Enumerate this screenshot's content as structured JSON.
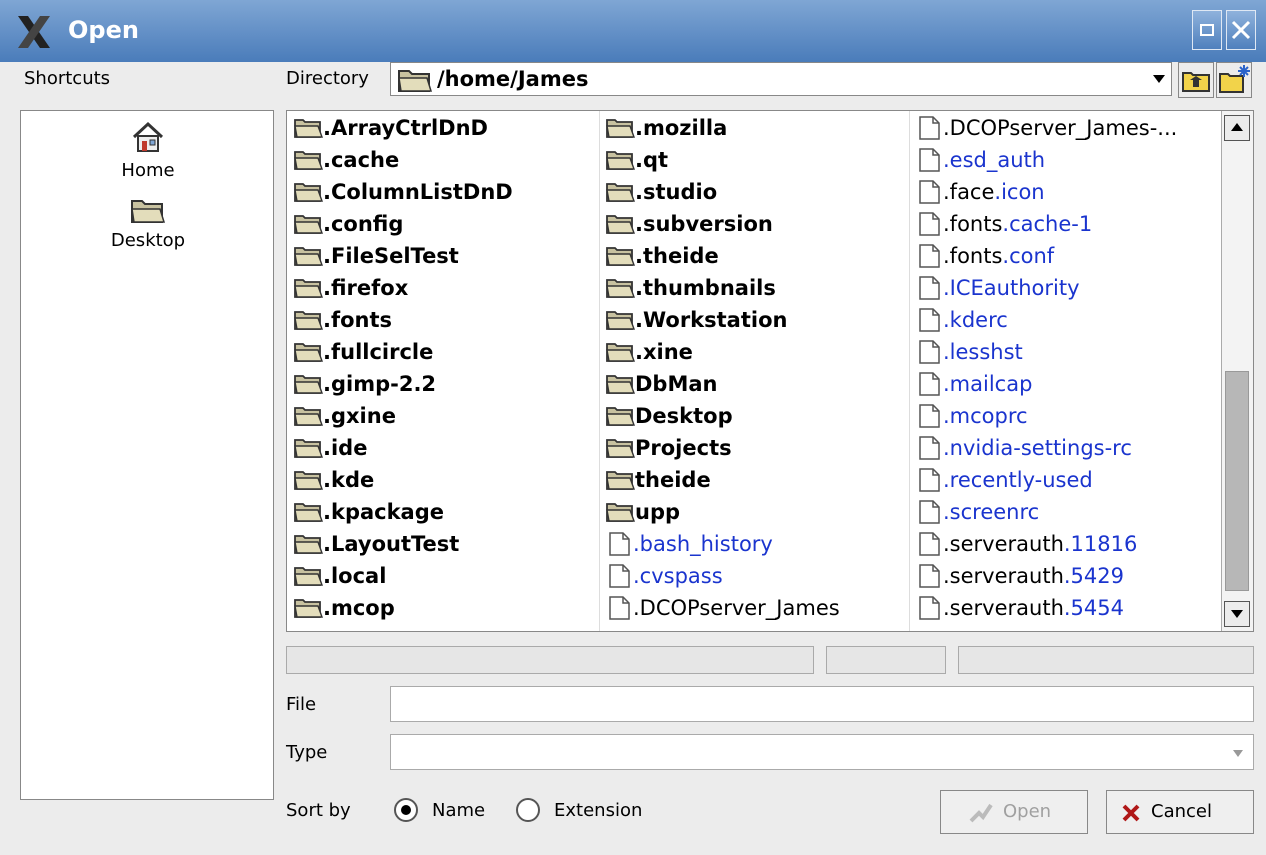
{
  "window": {
    "title": "Open"
  },
  "shortcuts": {
    "label": "Shortcuts",
    "items": [
      {
        "label": "Home"
      },
      {
        "label": "Desktop"
      }
    ]
  },
  "directory": {
    "label": "Directory",
    "value": "/home/James"
  },
  "files": {
    "columns": [
      [
        {
          "name": ".ArrayCtrlDnD",
          "type": "dir"
        },
        {
          "name": ".cache",
          "type": "dir"
        },
        {
          "name": ".ColumnListDnD",
          "type": "dir"
        },
        {
          "name": ".config",
          "type": "dir"
        },
        {
          "name": ".FileSelTest",
          "type": "dir"
        },
        {
          "name": ".firefox",
          "type": "dir"
        },
        {
          "name": ".fonts",
          "type": "dir"
        },
        {
          "name": ".fullcircle",
          "type": "dir"
        },
        {
          "name": ".gimp-2.2",
          "type": "dir"
        },
        {
          "name": ".gxine",
          "type": "dir"
        },
        {
          "name": ".ide",
          "type": "dir"
        },
        {
          "name": ".kde",
          "type": "dir"
        },
        {
          "name": ".kpackage",
          "type": "dir"
        },
        {
          "name": ".LayoutTest",
          "type": "dir"
        },
        {
          "name": ".local",
          "type": "dir"
        },
        {
          "name": ".mcop",
          "type": "dir"
        }
      ],
      [
        {
          "name": ".mozilla",
          "type": "dir"
        },
        {
          "name": ".qt",
          "type": "dir"
        },
        {
          "name": ".studio",
          "type": "dir"
        },
        {
          "name": ".subversion",
          "type": "dir"
        },
        {
          "name": ".theide",
          "type": "dir"
        },
        {
          "name": ".thumbnails",
          "type": "dir"
        },
        {
          "name": ".Workstation",
          "type": "dir"
        },
        {
          "name": ".xine",
          "type": "dir"
        },
        {
          "name": "DbMan",
          "type": "dir"
        },
        {
          "name": "Desktop",
          "type": "dir"
        },
        {
          "name": "Projects",
          "type": "dir"
        },
        {
          "name": "theide",
          "type": "dir"
        },
        {
          "name": "upp",
          "type": "dir"
        },
        {
          "name_a": "",
          "name_b": ".bash_history",
          "type": "file"
        },
        {
          "name_a": "",
          "name_b": ".cvspass",
          "type": "file"
        },
        {
          "name_a": ".DCOPserver_James",
          "name_b": "",
          "type": "file"
        }
      ],
      [
        {
          "name_a": ".DCOPserver_James-...",
          "name_b": "",
          "type": "file"
        },
        {
          "name_a": "",
          "name_b": ".esd_auth",
          "type": "file"
        },
        {
          "name_a": ".face",
          "name_b": ".icon",
          "type": "file"
        },
        {
          "name_a": ".fonts",
          "name_b": ".cache-1",
          "type": "file"
        },
        {
          "name_a": ".fonts",
          "name_b": ".conf",
          "type": "file"
        },
        {
          "name_a": "",
          "name_b": ".ICEauthority",
          "type": "file"
        },
        {
          "name_a": "",
          "name_b": ".kderc",
          "type": "file"
        },
        {
          "name_a": "",
          "name_b": ".lesshst",
          "type": "file"
        },
        {
          "name_a": "",
          "name_b": ".mailcap",
          "type": "file"
        },
        {
          "name_a": "",
          "name_b": ".mcoprc",
          "type": "file"
        },
        {
          "name_a": "",
          "name_b": ".nvidia-settings-rc",
          "type": "file"
        },
        {
          "name_a": "",
          "name_b": ".recently-used",
          "type": "file"
        },
        {
          "name_a": "",
          "name_b": ".screenrc",
          "type": "file"
        },
        {
          "name_a": ".serverauth",
          "name_b": ".11816",
          "type": "file"
        },
        {
          "name_a": ".serverauth",
          "name_b": ".5429",
          "type": "file"
        },
        {
          "name_a": ".serverauth",
          "name_b": ".5454",
          "type": "file"
        }
      ]
    ]
  },
  "form": {
    "file_label": "File",
    "file_value": "",
    "type_label": "Type",
    "type_value": "",
    "sort_label": "Sort by",
    "sort_name": "Name",
    "sort_ext": "Extension",
    "sort_selected": "Name"
  },
  "buttons": {
    "open": "Open",
    "cancel": "Cancel"
  },
  "colors": {
    "title_bar": "#4a7cba",
    "extension_text": "#1a34ce"
  }
}
